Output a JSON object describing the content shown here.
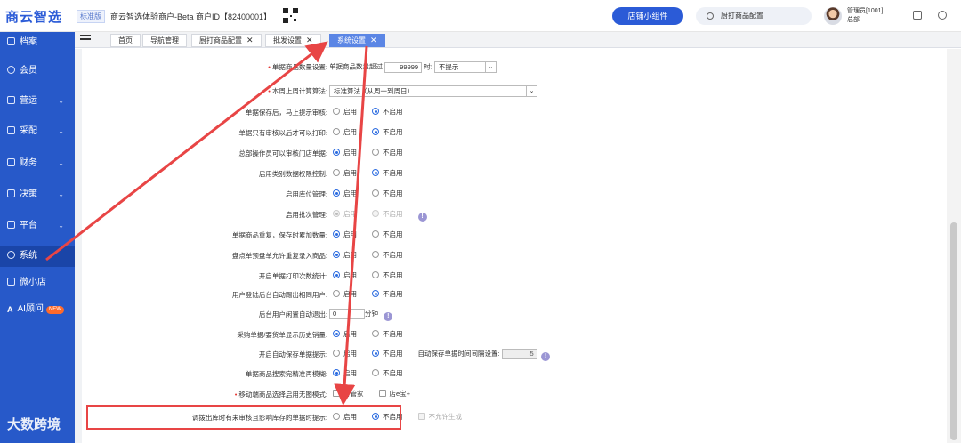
{
  "header": {
    "logo": "商云智选",
    "edition": "标准版",
    "merchant": "商云智选体验商户-Beta 商户ID【82400001】",
    "widget_button": "店铺小组件",
    "search_placeholder": "厨打商品配置",
    "user_name": "管理员[1001]",
    "user_sub": "总部"
  },
  "sidebar": {
    "items": [
      {
        "label": "档案",
        "arrow": ""
      },
      {
        "label": "会员",
        "arrow": ""
      },
      {
        "label": "营运",
        "arrow": "⌄"
      },
      {
        "label": "采配",
        "arrow": "⌄"
      },
      {
        "label": "财务",
        "arrow": "⌄"
      },
      {
        "label": "决策",
        "arrow": "⌄"
      },
      {
        "label": "平台",
        "arrow": "⌄"
      },
      {
        "label": "系统",
        "arrow": ""
      },
      {
        "label": "微小店",
        "arrow": ""
      },
      {
        "label": "AI顾问",
        "arrow": ""
      }
    ],
    "new_badge": "NEW",
    "watermark": "大数跨境"
  },
  "tabs": [
    {
      "label": "首页"
    },
    {
      "label": "导航管理"
    },
    {
      "label": "厨打商品配置"
    },
    {
      "label": "批发设置"
    },
    {
      "label": "系统设置"
    }
  ],
  "settings": {
    "opt_on": "启用",
    "opt_off": "不启用",
    "r1": {
      "label": "单据商品数量设置:",
      "text_a": "单据商品数量超过",
      "qty": "99999",
      "text_b": "时:",
      "select": "不提示"
    },
    "r2": {
      "label": "本周上周计算算法:",
      "select": "标准算法（从周一到周日）"
    },
    "r3": {
      "label": "单据保存后，马上提示审核:"
    },
    "r4": {
      "label": "单据只有审核以后才可以打印:"
    },
    "r5": {
      "label": "总部操作员可以审核门店单据:"
    },
    "r6": {
      "label": "启用类别数据权限控制:"
    },
    "r7": {
      "label": "启用库位管理:"
    },
    "r8": {
      "label": "启用批次管理:"
    },
    "r9": {
      "label": "单据商品重复，保存时累加数量:"
    },
    "r10": {
      "label": "盘点单预盘单允许重复录入商品:"
    },
    "r11": {
      "label": "开启单据打印次数统计:"
    },
    "r12": {
      "label": "用户登陆后台自动踢出相同用户:"
    },
    "r13": {
      "label": "后台用户闲置自动退出:",
      "value": "0",
      "unit": "分钟"
    },
    "r14": {
      "label": "采购单据/要货单显示历史销量:"
    },
    "r15": {
      "label": "开启自动保存单据提示:",
      "extra_label": "自动保存单据时间间隔设置:",
      "extra_value": "5"
    },
    "r16": {
      "label": "单据商品搜索完精准再模糊:"
    },
    "r17": {
      "label": "移动端商品选择启用无图模式:",
      "cb1": "智管家",
      "cb2": "店e宝+"
    },
    "r18": {
      "label": "调拨出库时有未审核且影响库存的单据时提示:",
      "extra": "不允许生成"
    }
  },
  "colors": {
    "brand": "#2b5bd7",
    "sidebar": "#2759c9",
    "active_tab": "#5b86e5",
    "annotation": "#e84545"
  }
}
